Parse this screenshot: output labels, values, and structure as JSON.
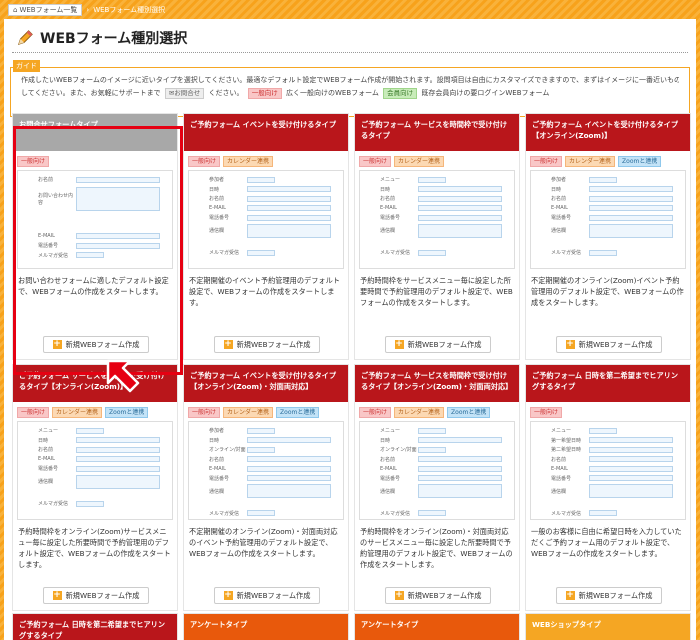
{
  "breadcrumb": {
    "home": "WEBフォーム一覧",
    "current": "WEBフォーム種別選択"
  },
  "page_title": "WEBフォーム種別選択",
  "guide": {
    "tag": "ガイド",
    "line1": "作成したいWEBフォームのイメージに近いタイプを選択してください。最適なデフォルト設定でWEBフォーム作成が開始されます。設問項目は自由にカスタマイズできますので、まずはイメージに一番近いものを選択",
    "line2a": "してください。また、お気軽にサポートまで",
    "support_chip": "お問合せ",
    "line2b": "ください。",
    "chip1": "一般向け",
    "line2c": "広く一般向けのWEBフォーム",
    "chip2": "会員向け",
    "line2d": "既存会員向けの要ログインWEBフォーム"
  },
  "labels": {
    "general": "一般向け",
    "calendar": "カレンダー連携",
    "zoom": "Zoomと連携",
    "create": "新規WEBフォーム作成"
  },
  "cards": [
    {
      "title": "お問合せフォームタイプ",
      "desc": "お問い合わせフォームに適したデフォルト設定で、WEBフォームの作成をスタートします。"
    },
    {
      "title": "ご予約フォーム イベントを受け付けるタイプ",
      "desc": "不定期開催のイベント予約管理用のデフォルト設定で、WEBフォームの作成をスタートします。"
    },
    {
      "title": "ご予約フォーム サービスを時間枠で受け付けるタイプ",
      "desc": "予約時間枠をサービスメニュー毎に設定した所要時間で予約管理用のデフォルト設定で、WEBフォームの作成をスタートします。"
    },
    {
      "title": "ご予約フォーム イベントを受け付けるタイプ【オンライン(Zoom)】",
      "desc": "不定期開催のオンライン(Zoom)イベント予約管理用のデフォルト設定で、WEBフォームの作成をスタートします。"
    },
    {
      "title": "ご予約フォーム サービスを時間枠で受け付けるタイプ【オンライン(Zoom)】",
      "desc": "予約時間枠をオンライン(Zoom)サービスメニュー毎に設定した所要時間で予約管理用のデフォルト設定で、WEBフォームの作成をスタートします。"
    },
    {
      "title": "ご予約フォーム イベントを受け付けるタイプ【オンライン(Zoom)・対面両対応】",
      "desc": "不定期開催のオンライン(Zoom)・対面両対応のイベント予約管理用のデフォルト設定で、WEBフォームの作成をスタートします。"
    },
    {
      "title": "ご予約フォーム サービスを時間枠で受け付けるタイプ【オンライン(Zoom)・対面両対応】",
      "desc": "予約時間枠をオンライン(Zoom)・対面両対応のサービスメニュー毎に設定した所要時間で予約管理用のデフォルト設定で、WEBフォームの作成をスタートします。"
    },
    {
      "title": "ご予約フォーム 日時を第二希望までヒアリングするタイプ",
      "desc": "一般のお客様に自由に希望日時を入力していただくご予約フォーム用のデフォルト設定で、WEBフォームの作成をスタートします。"
    },
    {
      "title": "ご予約フォーム 日時を第二希望までヒアリングするタイプ",
      "desc": ""
    },
    {
      "title": "アンケートタイプ",
      "desc": ""
    },
    {
      "title": "アンケートタイプ",
      "desc": ""
    },
    {
      "title": "WEBショップタイプ",
      "desc": ""
    }
  ],
  "thumb_fields": {
    "c0": [
      "お名前",
      "お問い合わせ内容",
      "",
      "",
      "E-MAIL",
      "電話番号",
      "メルマガ受信"
    ],
    "c1": [
      "参加者",
      "日時",
      "お名前",
      "E-MAIL",
      "電話番号",
      "通信欄",
      "",
      "メルマガ受信"
    ],
    "c2": [
      "メニュー",
      "日時",
      "お名前",
      "E-MAIL",
      "電話番号",
      "通信欄",
      "",
      "メルマガ受信"
    ],
    "c3": [
      "参加者",
      "日時",
      "お名前",
      "E-MAIL",
      "電話番号",
      "通信欄",
      "",
      "メルマガ受信"
    ],
    "c4": [
      "メニュー",
      "日時",
      "お名前",
      "E-MAIL",
      "電話番号",
      "通信欄",
      "",
      "メルマガ受信"
    ],
    "c5": [
      "参加者",
      "日時",
      "オンライン/対面",
      "お名前",
      "E-MAIL",
      "電話番号",
      "通信欄",
      "",
      "メルマガ受信"
    ],
    "c6": [
      "メニュー",
      "日時",
      "オンライン/対面",
      "お名前",
      "E-MAIL",
      "電話番号",
      "通信欄",
      "",
      "メルマガ受信"
    ],
    "c7": [
      "メニュー",
      "第一希望日時",
      "第二希望日時",
      "お名前",
      "E-MAIL",
      "電話番号",
      "通信欄",
      "",
      "メルマガ受信"
    ]
  },
  "colors": {
    "accent": "#f5a623",
    "red_header": "#b9161b",
    "gray_header": "#a8a8a8",
    "orange_header": "#e8590c",
    "yellow_header": "#f5a623",
    "highlight": "#e60012"
  }
}
